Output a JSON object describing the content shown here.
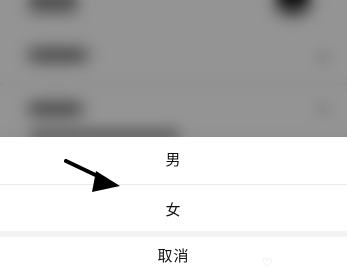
{
  "action_sheet": {
    "options": [
      {
        "label": "男"
      },
      {
        "label": "女"
      }
    ],
    "cancel_label": "取消"
  },
  "annotation": {
    "icon": "arrow-icon",
    "color": "#000000"
  },
  "colors": {
    "overlay": "#8f8f8f",
    "sheet_background": "#ffffff",
    "text": "#111111"
  }
}
